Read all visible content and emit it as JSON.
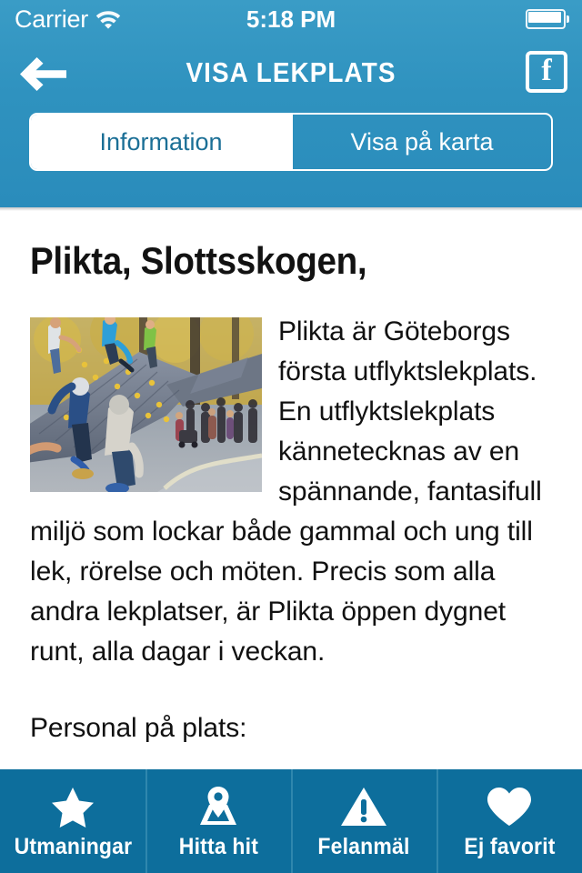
{
  "statusbar": {
    "carrier": "Carrier",
    "wifi_icon": "wifi-icon",
    "time": "5:18 PM",
    "battery_icon": "battery-full-icon"
  },
  "navbar": {
    "back_icon": "back-arrow-icon",
    "title": "VISA LEKPLATS",
    "share_icon": "facebook-icon",
    "share_glyph": "f"
  },
  "segments": {
    "items": [
      {
        "label": "Information",
        "active": true
      },
      {
        "label": "Visa på karta",
        "active": false
      }
    ]
  },
  "main": {
    "title": "Plikta, Slottsskogen,",
    "photo_alt": "children-playing-on-whale-play-structure",
    "paragraphs": [
      "Plikta är Göteborgs första utflyktslekplats. En utflyktslekplats kännetecknas av en spännande, fantasifull miljö som lockar både gammal och ung till lek, rörelse och möten. Precis som alla andra lekplatser, är Plikta öppen dygnet runt, alla dagar i veckan.",
      "Personal på plats:"
    ]
  },
  "tabbar": {
    "items": [
      {
        "icon": "star-icon",
        "label": "Utmaningar"
      },
      {
        "icon": "map-pin-icon",
        "label": "Hitta hit"
      },
      {
        "icon": "warning-icon",
        "label": "Felanmäl"
      },
      {
        "icon": "heart-icon",
        "label": "Ej favorit"
      }
    ]
  },
  "colors": {
    "header_blue": "#2f92bf",
    "tabbar_blue": "#0d6e9c",
    "active_segment_text": "#1b6f96",
    "white": "#ffffff",
    "body_text": "#111111"
  }
}
